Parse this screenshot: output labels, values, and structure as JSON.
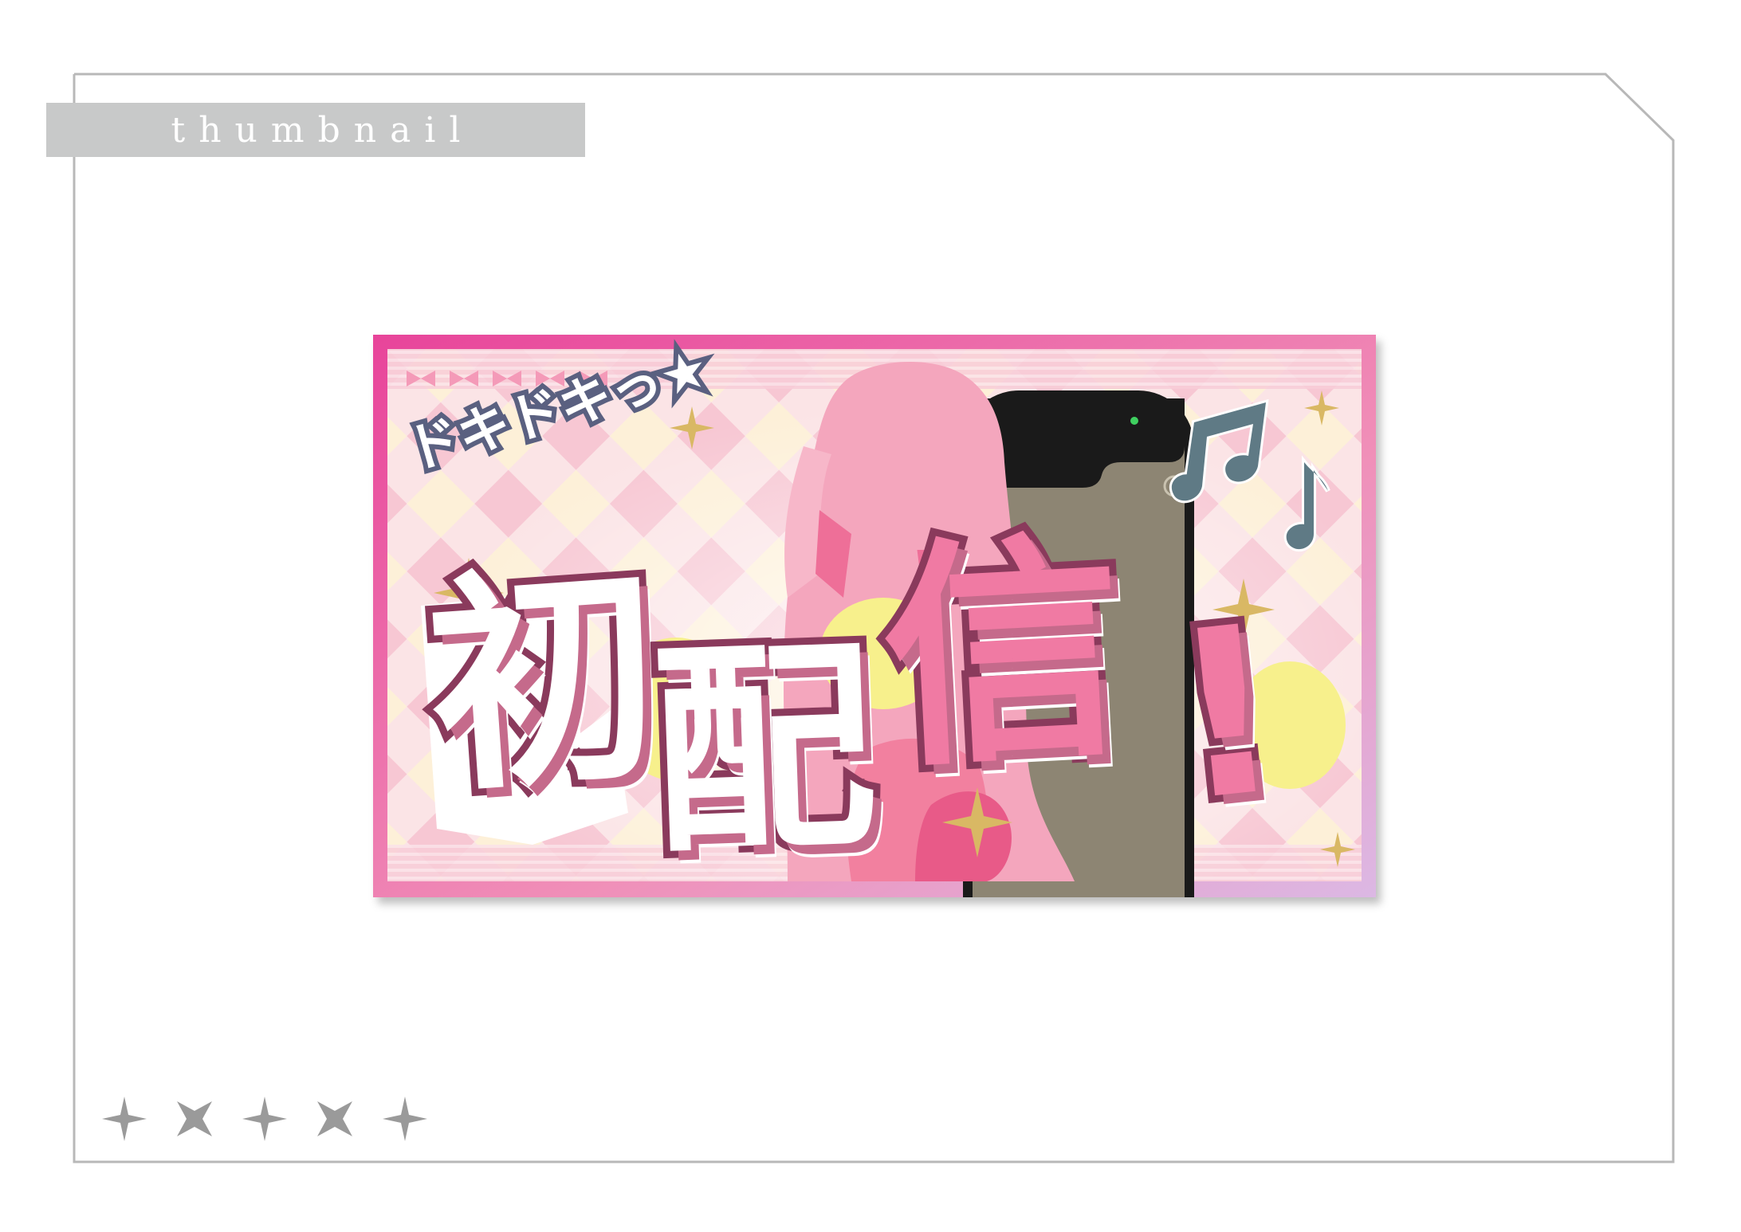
{
  "frame": {
    "label": "thumbnail",
    "footer_stars": [
      "sparkle-star",
      "four-point-star",
      "sparkle-star",
      "four-point-star",
      "sparkle-star"
    ]
  },
  "thumbnail": {
    "subtitle": "ドキドキっ★",
    "title_chars": [
      "初",
      "配",
      "信",
      "!"
    ],
    "colors": {
      "border": "#ee5a9e",
      "background": "#f9d6df",
      "accent_pink": "#f07aa3",
      "accent_yellow": "#f7f08c",
      "outline": "#8a3a5c",
      "note": "#5f7a85",
      "sparkle": "#d9b864"
    },
    "icons": [
      "ribbon-icon",
      "smartphone-icon",
      "music-note-icon",
      "sparkle-icon",
      "character-silhouette"
    ]
  }
}
